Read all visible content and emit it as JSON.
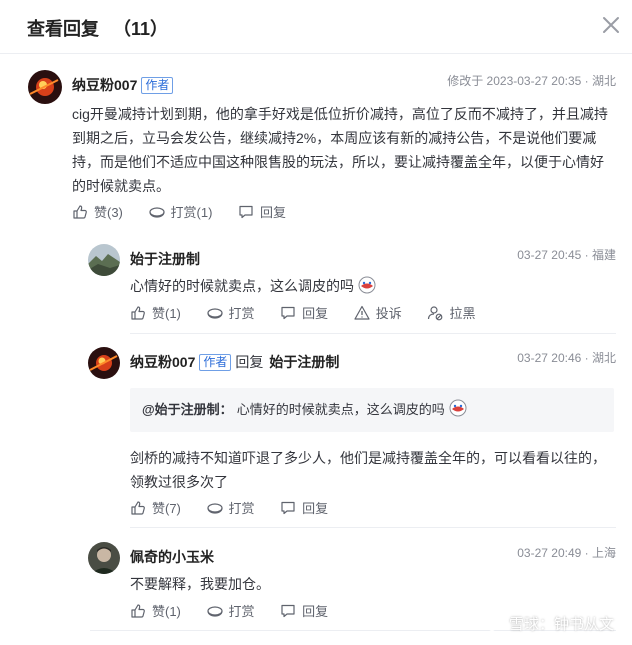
{
  "header": {
    "title": "查看回复",
    "count": "（11）"
  },
  "comments": [
    {
      "name": "纳豆粉007",
      "author_tag": "作者",
      "meta_time": "修改于 2023-03-27 20:35",
      "location": "湖北",
      "text": "cig开曼减持计划到期，他的拿手好戏是低位折价减持，高位了反而不减持了，并且减持到期之后，立马会发公告，继续减持2%，本周应该有新的减持公告，不是说他们要减持，而是他们不适应中国这种限售股的玩法，所以，要让减持覆盖全年，以便于心情好的时候就卖点。",
      "actions": {
        "like": "赞(3)",
        "reward": "打赏(1)",
        "reply": "回复"
      }
    },
    {
      "name": "始于注册制",
      "meta_time": "03-27 20:45",
      "location": "福建",
      "text": "心情好的时候就卖点，这么调皮的吗",
      "actions": {
        "like": "赞(1)",
        "reward": "打赏",
        "reply": "回复",
        "report": "投诉",
        "block": "拉黑"
      }
    },
    {
      "name": "纳豆粉007",
      "author_tag": "作者",
      "reply_word": "回复",
      "reply_to": "始于注册制",
      "meta_time": "03-27 20:46",
      "location": "湖北",
      "quote_name": "@始于注册制：",
      "quote_text": "心情好的时候就卖点，这么调皮的吗",
      "text": "剑桥的减持不知道吓退了多少人，他们是减持覆盖全年的，可以看看以往的，领教过很多次了",
      "actions": {
        "like": "赞(7)",
        "reward": "打赏",
        "reply": "回复"
      }
    },
    {
      "name": "佩奇的小玉米",
      "meta_time": "03-27 20:49",
      "location": "上海",
      "text": "不要解释，我要加仓。",
      "actions": {
        "like": "赞(1)",
        "reward": "打赏",
        "reply": "回复"
      }
    }
  ],
  "watermark": {
    "text": "雪球：钟书从文"
  },
  "colors": {
    "accent": "#2b6cd8",
    "meta": "#8a8d96",
    "quote_bg": "#f5f6f8"
  }
}
